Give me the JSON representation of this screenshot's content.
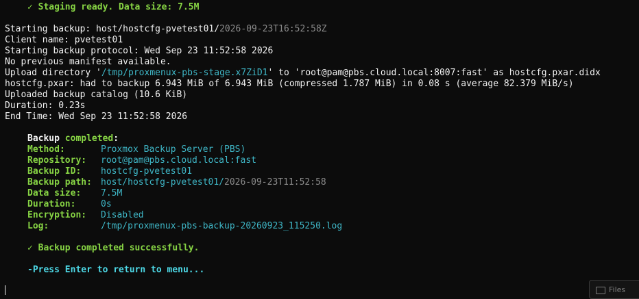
{
  "header": {
    "staging_ready": "✓ Staging ready. Data size: 7.5M"
  },
  "log": {
    "starting_backup_prefix": "Starting backup: host/hostcfg-pvetest01/",
    "starting_backup_ts": "2026-09-23T16:52:58Z",
    "client_name": "Client name: pvetest01",
    "protocol": "Starting backup protocol: Wed Sep 23 11:52:58 2026",
    "no_manifest": "No previous manifest available.",
    "upload_pre": "Upload directory '",
    "upload_dir": "/tmp/proxmenux-pbs-stage.x7ZiD1",
    "upload_post": "' to 'root@pam@pbs.cloud.local:8007:fast' as hostcfg.pxar.didx",
    "pxar": "hostcfg.pxar: had to backup 6.943 MiB of 6.943 MiB (compressed 1.787 MiB) in 0.08 s (average 82.379 MiB/s)",
    "catalog": "Uploaded backup catalog (10.6 KiB)",
    "duration": "Duration: 0.23s",
    "end_time": "End Time: Wed Sep 23 11:52:58 2026"
  },
  "summary": {
    "title_word": "Backup",
    "title_status": "completed",
    "title_colon": ":",
    "rows": [
      {
        "label": "Method:",
        "value": "Proxmox Backup Server (PBS)"
      },
      {
        "label": "Repository:",
        "value": "root@pam@pbs.cloud.local:fast"
      },
      {
        "label": "Backup ID:",
        "value": "hostcfg-pvetest01"
      },
      {
        "label": "Backup path:",
        "value": "host/hostcfg-pvetest01/",
        "value_tail": "2026-09-23T11:52:58"
      },
      {
        "label": "Data size:",
        "value": "7.5M"
      },
      {
        "label": "Duration:",
        "value": "0s"
      },
      {
        "label": "Encryption:",
        "value": "Disabled"
      },
      {
        "label": "Log:",
        "value": "/tmp/proxmenux-pbs-backup-20260923_115250.log"
      }
    ]
  },
  "footer": {
    "success": "✓ Backup completed successfully.",
    "prompt": "-Press Enter to return to menu..."
  },
  "files_button": {
    "label": "Files",
    "icon": "folder-icon"
  },
  "colors": {
    "background": "#0c0c0c",
    "green": "#87d444",
    "cyan": "#3fb7c7",
    "prompt": "#4dd8e6",
    "dim": "#8c8c8c"
  }
}
